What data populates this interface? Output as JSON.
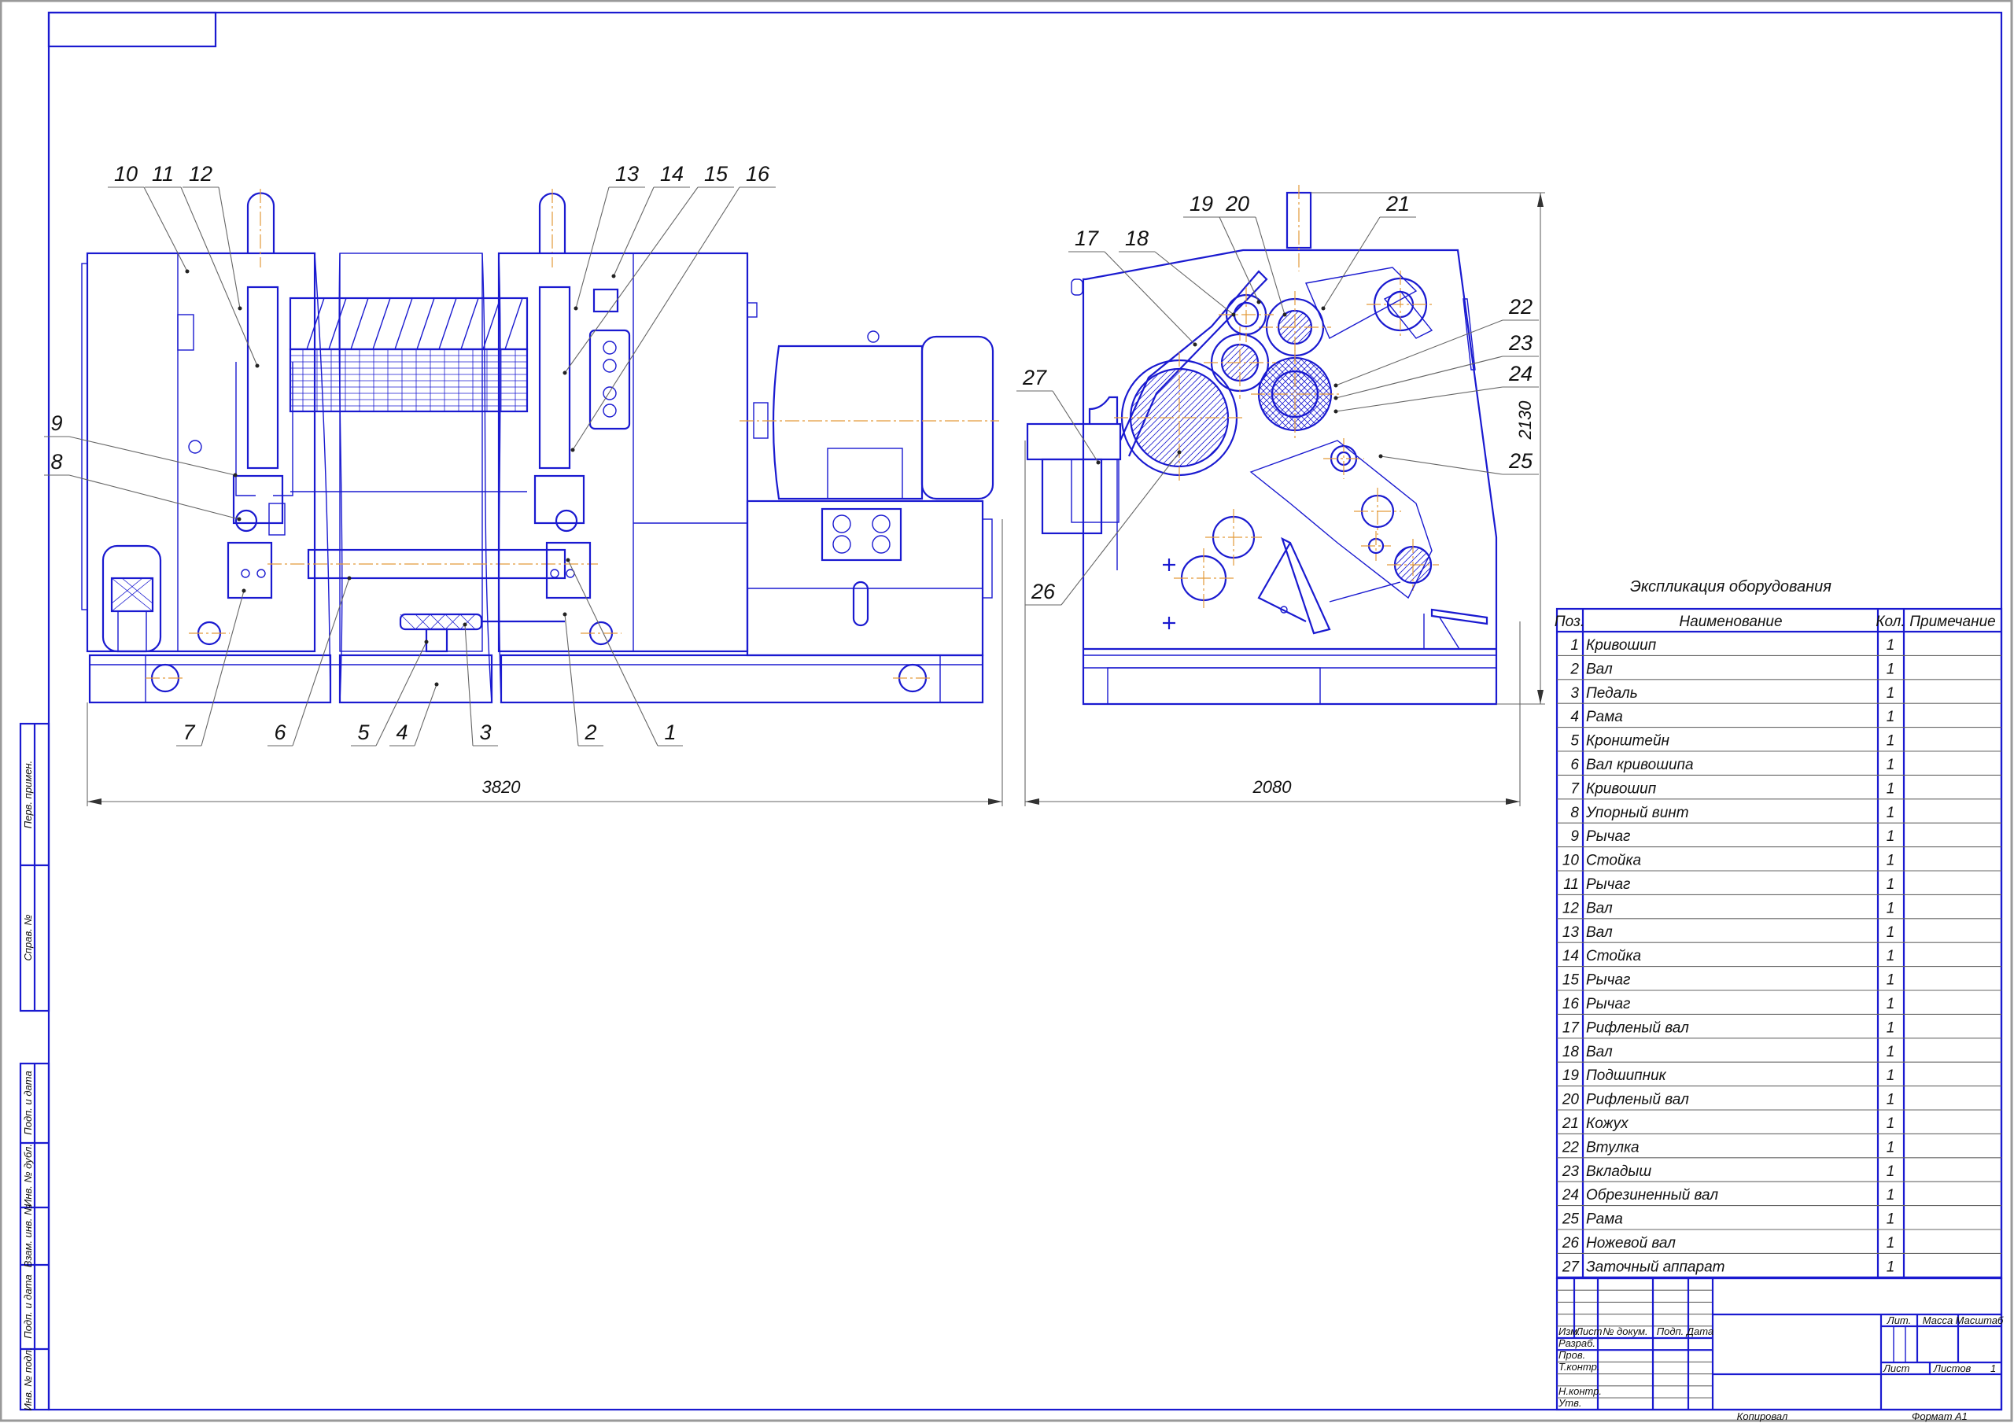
{
  "colors": {
    "line": "#1a1ad0",
    "centerline": "#e39a3a",
    "leader": "#666666"
  },
  "front_view": {
    "balloons": [
      "1",
      "2",
      "3",
      "4",
      "5",
      "6",
      "7",
      "8",
      "9",
      "10",
      "11",
      "12",
      "13",
      "14",
      "15",
      "16"
    ],
    "dimension_width": "3820"
  },
  "side_view": {
    "balloons": [
      "17",
      "18",
      "19",
      "20",
      "21",
      "22",
      "23",
      "24",
      "25",
      "26",
      "27"
    ],
    "dimension_width": "2080",
    "dimension_height": "2130"
  },
  "spec_table": {
    "title": "Экспликация оборудования",
    "headers": {
      "pos": "Поз.",
      "name": "Наименование",
      "qty": "Кол.",
      "note": "Примечание"
    },
    "rows": [
      {
        "pos": "1",
        "name": "Кривошип",
        "qty": "1"
      },
      {
        "pos": "2",
        "name": "Вал",
        "qty": "1"
      },
      {
        "pos": "3",
        "name": "Педаль",
        "qty": "1"
      },
      {
        "pos": "4",
        "name": "Рама",
        "qty": "1"
      },
      {
        "pos": "5",
        "name": "Кронштейн",
        "qty": "1"
      },
      {
        "pos": "6",
        "name": "Вал кривошипа",
        "qty": "1"
      },
      {
        "pos": "7",
        "name": "Кривошип",
        "qty": "1"
      },
      {
        "pos": "8",
        "name": "Упорный винт",
        "qty": "1"
      },
      {
        "pos": "9",
        "name": "Рычаг",
        "qty": "1"
      },
      {
        "pos": "10",
        "name": "Стойка",
        "qty": "1"
      },
      {
        "pos": "11",
        "name": "Рычаг",
        "qty": "1"
      },
      {
        "pos": "12",
        "name": "Вал",
        "qty": "1"
      },
      {
        "pos": "13",
        "name": "Вал",
        "qty": "1"
      },
      {
        "pos": "14",
        "name": "Стойка",
        "qty": "1"
      },
      {
        "pos": "15",
        "name": "Рычаг",
        "qty": "1"
      },
      {
        "pos": "16",
        "name": "Рычаг",
        "qty": "1"
      },
      {
        "pos": "17",
        "name": "Рифленый вал",
        "qty": "1"
      },
      {
        "pos": "18",
        "name": "Вал",
        "qty": "1"
      },
      {
        "pos": "19",
        "name": "Подшипник",
        "qty": "1"
      },
      {
        "pos": "20",
        "name": "Рифленый вал",
        "qty": "1"
      },
      {
        "pos": "21",
        "name": "Кожух",
        "qty": "1"
      },
      {
        "pos": "22",
        "name": "Втулка",
        "qty": "1"
      },
      {
        "pos": "23",
        "name": "Вкладыш",
        "qty": "1"
      },
      {
        "pos": "24",
        "name": "Обрезиненный вал",
        "qty": "1"
      },
      {
        "pos": "25",
        "name": "Рама",
        "qty": "1"
      },
      {
        "pos": "26",
        "name": "Ножевой вал",
        "qty": "1"
      },
      {
        "pos": "27",
        "name": "Заточный аппарат",
        "qty": "1"
      }
    ]
  },
  "title_block": {
    "izm": "Изм.",
    "list": "Лист",
    "doc_no": "№ докум.",
    "sign": "Подп.",
    "date": "Дата",
    "razrab": "Разраб.",
    "prov": "Пров.",
    "tkontr": "Т.контр.",
    "nkontr": "Н.контр.",
    "utv": "Утв.",
    "lit": "Лит.",
    "massa": "Масса",
    "masshtab": "Масштаб",
    "sheet": "Лист",
    "sheets": "Листов",
    "sheets_count": "1",
    "copied": "Копировал",
    "format_label": "Формат",
    "format": "A1"
  },
  "side_stamp": {
    "perv_primen": "Перв. примен.",
    "sprav_no": "Справ. №",
    "podp_data_1": "Подп. и дата",
    "inv_dubl": "Инв. № дубл.",
    "vzam_inv": "Взам. инв. №",
    "podp_data_2": "Подп. и дата",
    "inv_podl": "Инв. № подл."
  }
}
